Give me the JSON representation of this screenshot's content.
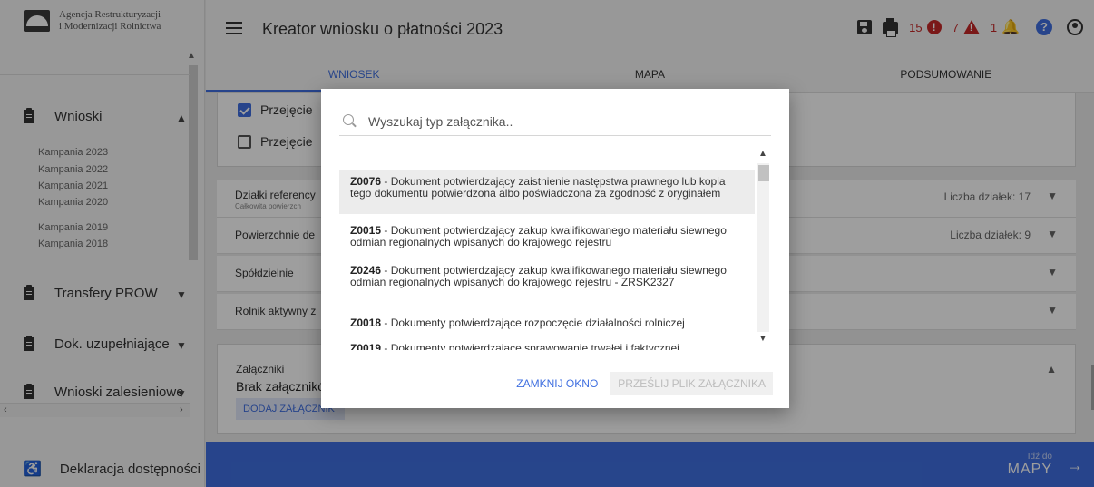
{
  "sidebar": {
    "org_line1": "Agencja Restrukturyzacji",
    "org_line2": "i Modernizacji Rolnictwa",
    "wnioski_label": "Wnioski",
    "campaigns": [
      "Kampania 2023",
      "Kampania 2022",
      "Kampania 2021",
      "Kampania 2020",
      "Kampania 2019",
      "Kampania 2018"
    ],
    "transfery_label": "Transfery PROW",
    "dok_label": "Dok. uzupełniające",
    "zalesieniowe_label": "Wnioski zalesieniowe",
    "access_label": "Deklaracja dostępności"
  },
  "header": {
    "title": "Kreator wniosku o płatności 2023",
    "errors_count": "15",
    "warnings_count": "7",
    "notifications_count": "1"
  },
  "tabs": [
    "WNIOSEK",
    "MAPA",
    "PODSUMOWANIE"
  ],
  "background": {
    "checkbox1": "Przejęcie",
    "checkbox2": "Przejęcie",
    "row_dzialki": "Działki referency",
    "row_dzialki_sub": "Całkowita powierzch",
    "row_dzialki_meta": "Liczba działek: 17",
    "row_powierzchnie": "Powierzchnie de",
    "row_powierzchnie_meta": "Liczba działek: 9",
    "row_spoldzielnie": "Spółdzielnie",
    "row_rolnik": "Rolnik aktywny z",
    "attachments_label": "Załączniki",
    "attachments_empty": "Brak załącznikó",
    "add_attachment": "DODAJ ZAŁĄCZNIK"
  },
  "footer": {
    "small": "Idź do",
    "big": "MAPY"
  },
  "modal": {
    "search_placeholder": "Wyszukaj typ załącznika..",
    "items": [
      {
        "code": "Z0076",
        "text": " - Dokument potwierdzający zaistnienie następstwa prawnego lub kopia tego dokumentu potwierdzona albo poświadczona za zgodność z oryginałem"
      },
      {
        "code": "Z0015",
        "text": " - Dokument potwierdzający zakup kwalifikowanego materiału siewnego odmian regionalnych wpisanych do krajowego rejestru"
      },
      {
        "code": "Z0246",
        "text": " - Dokument potwierdzający zakup kwalifikowanego materiału siewnego odmian regionalnych wpisanych do krajowego rejestru - ZRSK2327"
      },
      {
        "code": "Z0018",
        "text": " - Dokumenty potwierdzające rozpoczęcie działalności rolniczej"
      },
      {
        "code": "Z0019",
        "text": " - Dokumenty potwierdzające sprawowanie trwałej i faktycznej"
      }
    ],
    "close_label": "ZAMKNIJ OKNO",
    "upload_label": "PRZEŚLIJ PLIK ZAŁĄCZNIKA"
  },
  "colors": {
    "accent": "#3f6fe0",
    "error": "#c62828"
  }
}
